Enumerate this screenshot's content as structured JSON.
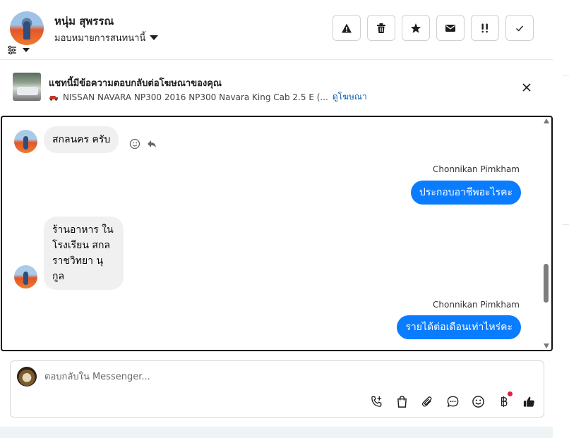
{
  "header": {
    "contact_name": "หนุ่ม สุพรรณ",
    "assign_label": "มอบหมายการสนทนานี้",
    "actions": [
      {
        "name": "spam",
        "icon": "warning-icon"
      },
      {
        "name": "delete",
        "icon": "trash-icon"
      },
      {
        "name": "star",
        "icon": "star-icon"
      },
      {
        "name": "mark-unread",
        "icon": "envelope-icon"
      },
      {
        "name": "follow-up",
        "icon": "exclamation-icon"
      },
      {
        "name": "done",
        "icon": "check-icon"
      }
    ]
  },
  "ad_banner": {
    "title": "แชทนี้มีข้อความตอบกลับต่อโฆษณาของคุณ",
    "listing": "NISSAN NAVARA NP300 2016 NP300 Navara King Cab 2.5 E (...",
    "view_ad_link": "ดูโฆษณา"
  },
  "conversation": {
    "messages": [
      {
        "direction": "in",
        "text": "สกลนคร ครับ"
      },
      {
        "direction": "out",
        "sender": "Chonnikan Pimkham",
        "text": "ประกอบอาชีพอะไรคะ"
      },
      {
        "direction": "in",
        "text": "ร้านอาหาร ในโรงเรียน สกลราชวิทยา นุกูล"
      },
      {
        "direction": "out",
        "sender": "Chonnikan Pimkham",
        "text": "รายได้ต่อเดือนเท่าไหร่คะ"
      }
    ]
  },
  "composer": {
    "placeholder": "ตอบกลับใน Messenger...",
    "tools": [
      "call-add-icon",
      "shopping-bag-icon",
      "paperclip-icon",
      "chat-bubble-icon",
      "emoji-icon",
      "baht-icon",
      "thumbs-up-icon"
    ]
  },
  "colors": {
    "outgoing_bubble": "#0a7cff",
    "incoming_bubble": "#f0f0f0",
    "link": "#0a62b0",
    "notification_dot": "#e41e3f"
  }
}
